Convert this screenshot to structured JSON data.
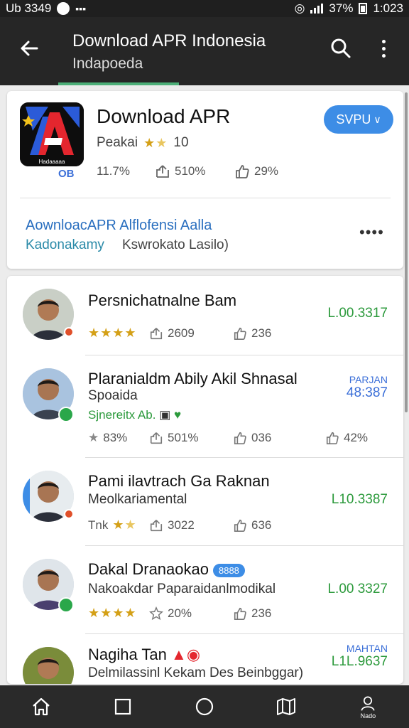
{
  "status_bar": {
    "left_text": "Ub 3349",
    "battery_text": "37%",
    "time": "1:023"
  },
  "app_bar": {
    "title": "Download APR Indonesia",
    "subtitle": "Indapoeda"
  },
  "app_card": {
    "name": "Download APR",
    "rating_label": "Peakai",
    "rating_stars_filled": 1,
    "rating_stars_total": 2,
    "rating_value": "10",
    "badge": "OB",
    "stats": [
      "11.7%",
      "510%",
      "29%"
    ],
    "save_label": "SVPU",
    "link_text": "AownloacAPR Alflofensi Aalla",
    "tag_text": "Kadonakamy",
    "tag_desc": "Kswrokato Lasilo)",
    "more_label": "••••",
    "icon_letter": "A",
    "icon_caption": "Hadaaaaa"
  },
  "list": [
    {
      "title": "Persnichatnalne Bam",
      "stars": 4,
      "stats": [
        "2609",
        "236"
      ],
      "price_top": "",
      "price": "L.00.3317",
      "price_color": "green",
      "badge": "flag"
    },
    {
      "title": "Plaranialdm Abily Akil Shnasal",
      "subtitle": "Spoaida",
      "green": "Sjnereitx Ab.",
      "stats": [
        "83%",
        "501%",
        "036",
        "42%"
      ],
      "price_top": "PARJAN",
      "price": "48:387",
      "price_color": "blue",
      "badge": "verified"
    },
    {
      "title": "Pami ilavtrach Ga Raknan",
      "subtitle": "Meolkariamental",
      "stars_label": "Tnk",
      "stars": 2,
      "stats": [
        "3022",
        "636"
      ],
      "price_top": "",
      "price": "L10.3387",
      "price_color": "green",
      "badge": "flag"
    },
    {
      "title": "Dakal Dranaokao",
      "pill": "8888",
      "subtitle": "Nakoakdar Paparaidanlmodikal",
      "stars": 4,
      "stats": [
        "20%",
        "236"
      ],
      "price_top": "",
      "price": "L.00 3327",
      "price_color": "green",
      "badge": "verified"
    },
    {
      "title": "Nagiha Tan",
      "subtitle": "Delmilassinl Kekam Des Beinbggar)",
      "price_top": "MAHTAN",
      "price": "L1L.9637",
      "price_color": "blue",
      "badge": "none"
    }
  ],
  "nav": {
    "profile_label": "Nado"
  },
  "colors": {
    "accent_blue": "#3d8de6",
    "accent_green": "#2c9a3c",
    "appbar": "#262626"
  }
}
